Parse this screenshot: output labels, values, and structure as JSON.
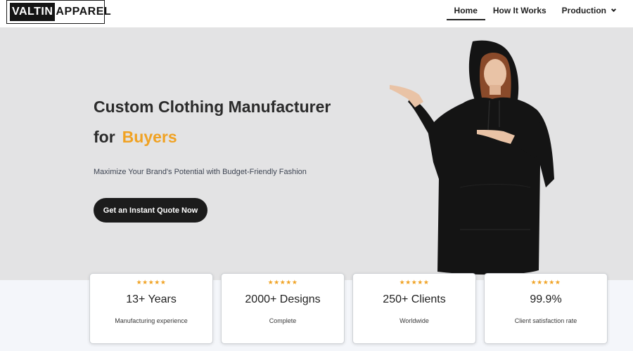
{
  "brand": {
    "logo_part1": "VALTIN",
    "logo_part2": "APPAREL"
  },
  "nav": {
    "items": [
      {
        "label": "Home",
        "active": true
      },
      {
        "label": "How It Works",
        "active": false
      },
      {
        "label": "Production",
        "active": false,
        "has_dropdown": true
      }
    ]
  },
  "hero": {
    "title_line1": "Custom Clothing Manufacturer",
    "title_line2_prefix": "for",
    "title_line2_accent": "Buyers",
    "subtitle": "Maximize Your Brand's Potential with Budget-Friendly Fashion",
    "cta_label": "Get an Instant Quote Now"
  },
  "stats": [
    {
      "stars": "★★★★★",
      "value": "13+ Years",
      "label": "Manufacturing experience"
    },
    {
      "stars": "★★★★★",
      "value": "2000+ Designs",
      "label": "Complete"
    },
    {
      "stars": "★★★★★",
      "value": "250+ Clients",
      "label": "Worldwide"
    },
    {
      "stars": "★★★★★",
      "value": "99.9%",
      "label": "Client satisfaction rate"
    }
  ],
  "colors": {
    "accent": "#f0a223",
    "button_bg": "#1c1c1c",
    "hero_bg": "#e3e3e4"
  }
}
